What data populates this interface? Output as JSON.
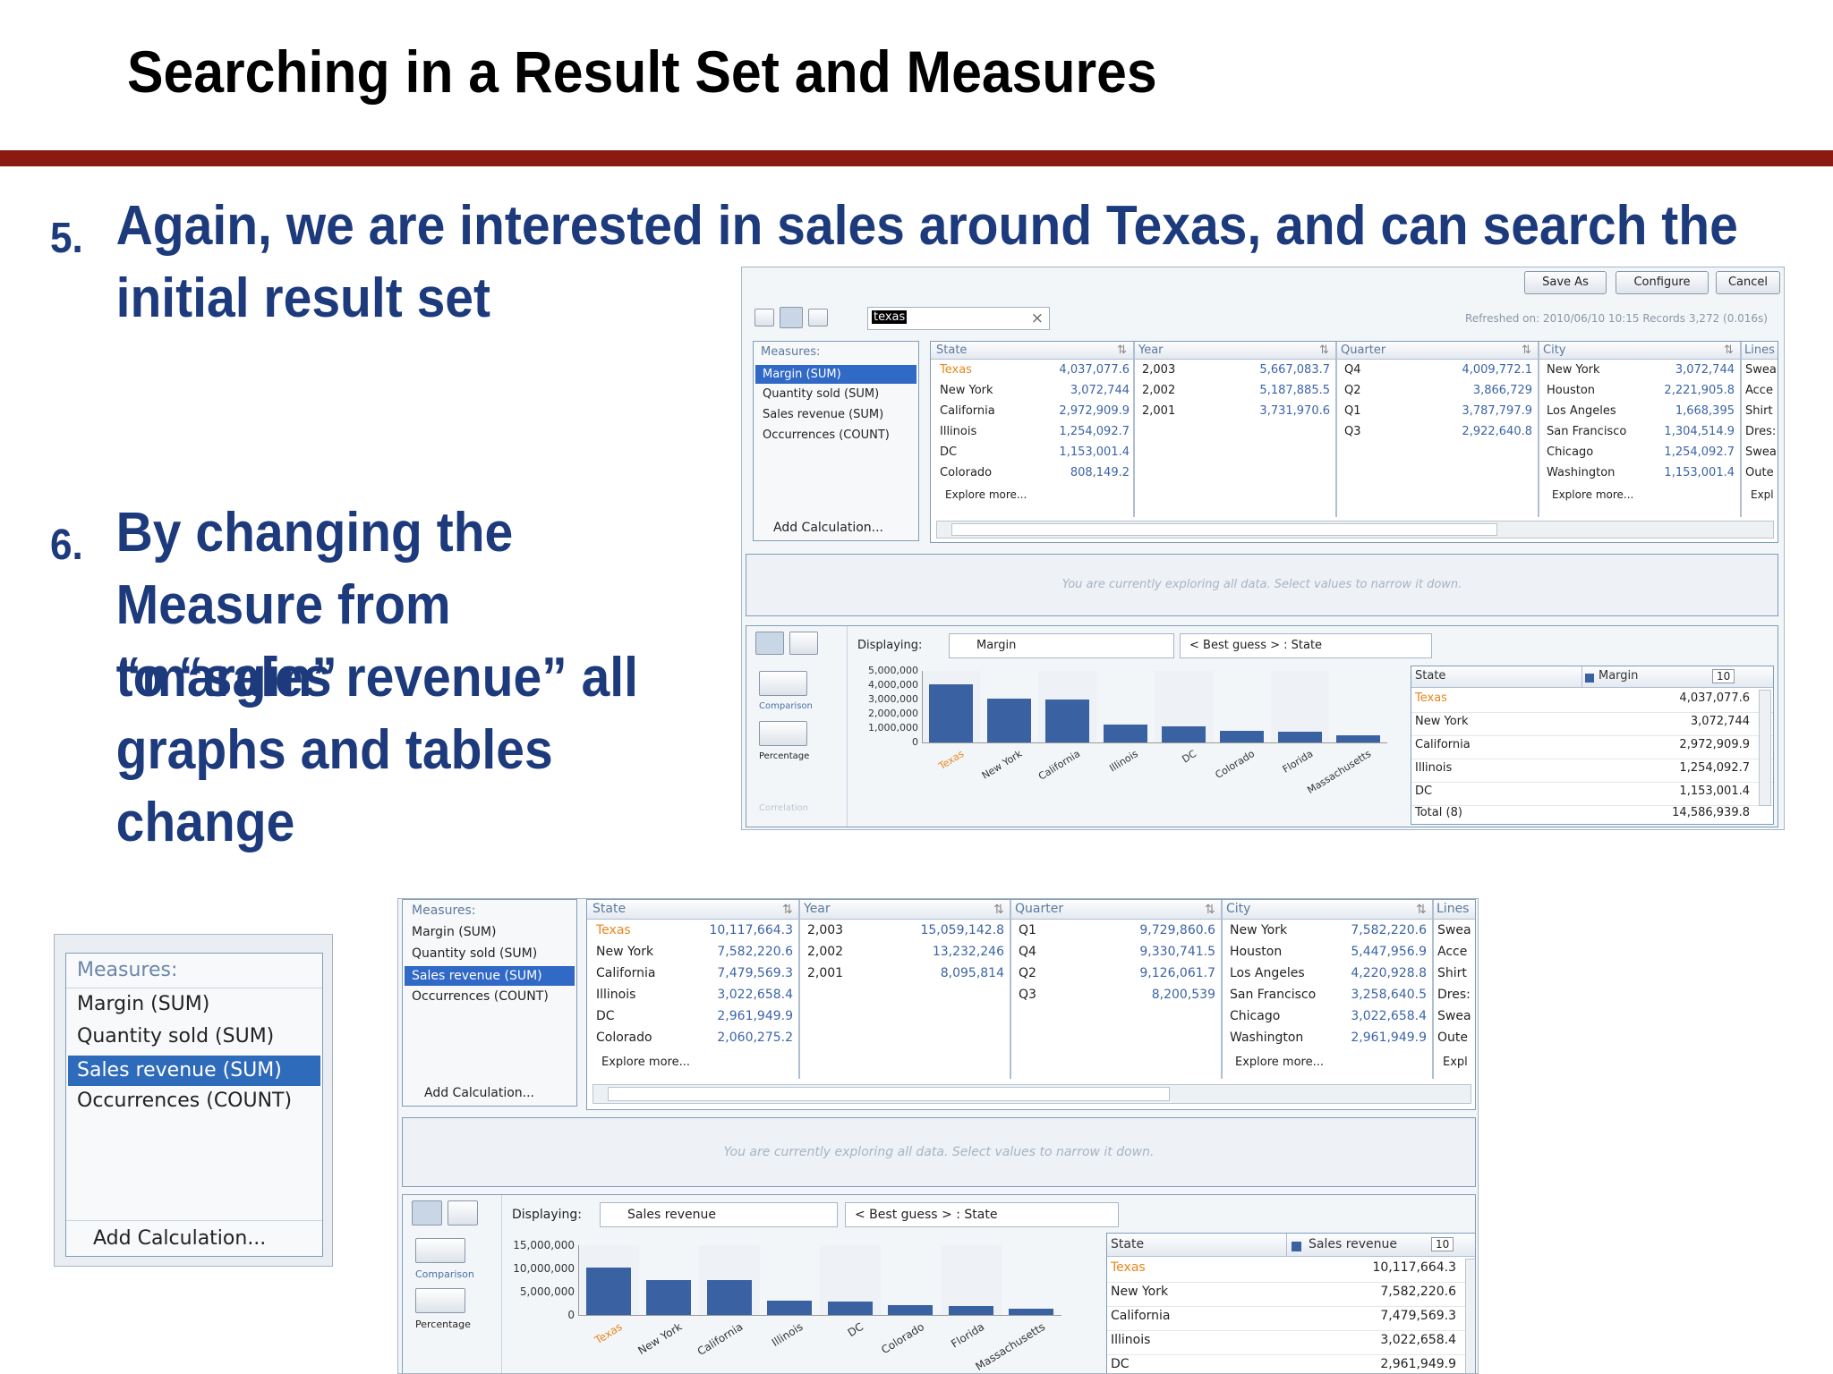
{
  "slide": {
    "title": "Searching in a Result Set and Measures",
    "b5_num": "5.",
    "b5_line1": "Again, we are interested in sales around Texas, and can search the",
    "b5_line2": "initial result set",
    "b6_num": "6.",
    "b6_lines": [
      "By changing the",
      "Measure from “margin”",
      "to “sales revenue” all",
      "graphs and tables",
      "change"
    ]
  },
  "top": {
    "buttons": {
      "save_as": "Save As",
      "configure": "Configure",
      "cancel": "Cancel"
    },
    "search_value": "texas",
    "clear_glyph": "×",
    "refreshed": "Refreshed on: 2010/06/10 10:15 Records 3,272 (0.016s)",
    "measures": {
      "header": "Measures:",
      "items": [
        "Margin (SUM)",
        "Quantity sold (SUM)",
        "Sales revenue (SUM)",
        "Occurrences (COUNT)"
      ],
      "selected": 0,
      "add": "Add Calculation..."
    },
    "facets": {
      "state": {
        "header": "State",
        "names": [
          "Texas",
          "New York",
          "California",
          "Illinois",
          "DC",
          "Colorado"
        ],
        "values": [
          "4,037,077.6",
          "3,072,744",
          "2,972,909.9",
          "1,254,092.7",
          "1,153,001.4",
          "808,149.2"
        ],
        "more": "Explore more..."
      },
      "year": {
        "header": "Year",
        "names": [
          "2,003",
          "2,002",
          "2,001"
        ],
        "values": [
          "5,667,083.7",
          "5,187,885.5",
          "3,731,970.6"
        ]
      },
      "quarter": {
        "header": "Quarter",
        "names": [
          "Q4",
          "Q2",
          "Q1",
          "Q3"
        ],
        "values": [
          "4,009,772.1",
          "3,866,729",
          "3,787,797.9",
          "2,922,640.8"
        ]
      },
      "city": {
        "header": "City",
        "names": [
          "New York",
          "Houston",
          "Los Angeles",
          "San Francisco",
          "Chicago",
          "Washington"
        ],
        "values": [
          "3,072,744",
          "2,221,905.8",
          "1,668,395",
          "1,304,514.9",
          "1,254,092.7",
          "1,153,001.4"
        ],
        "more": "Explore more..."
      },
      "lines": {
        "header": "Lines",
        "names": [
          "Swea",
          "Acce",
          "Shirt",
          "Dres:",
          "Swea",
          "Oute"
        ],
        "more": "Expl"
      }
    },
    "note": "You are currently exploring all data. Select values to narrow it down.",
    "displaying_label": "Displaying:",
    "measure_dd": "Margin",
    "dimension_dd": "< Best guess > : State",
    "side": {
      "comparison": "Comparison",
      "percentage": "Percentage",
      "correlation": "Correlation"
    },
    "table": {
      "col1": "State",
      "col2": "Margin",
      "count": "10",
      "rows": [
        [
          "Texas",
          "4,037,077.6"
        ],
        [
          "New York",
          "3,072,744"
        ],
        [
          "California",
          "2,972,909.9"
        ],
        [
          "Illinois",
          "1,254,092.7"
        ],
        [
          "DC",
          "1,153,001.4"
        ]
      ],
      "total_label": "Total (8)",
      "total_value": "14,586,939.8"
    }
  },
  "zoom": {
    "header": "Measures:",
    "items": [
      "Margin (SUM)",
      "Quantity sold (SUM)",
      "Sales revenue (SUM)",
      "Occurrences (COUNT)"
    ],
    "selected": 2,
    "add": "Add Calculation..."
  },
  "bottom": {
    "measures": {
      "header": "Measures:",
      "items": [
        "Margin (SUM)",
        "Quantity sold (SUM)",
        "Sales revenue (SUM)",
        "Occurrences (COUNT)"
      ],
      "selected": 2,
      "add": "Add Calculation..."
    },
    "facets": {
      "state": {
        "header": "State",
        "names": [
          "Texas",
          "New York",
          "California",
          "Illinois",
          "DC",
          "Colorado"
        ],
        "values": [
          "10,117,664.3",
          "7,582,220.6",
          "7,479,569.3",
          "3,022,658.4",
          "2,961,949.9",
          "2,060,275.2"
        ],
        "more": "Explore more..."
      },
      "year": {
        "header": "Year",
        "names": [
          "2,003",
          "2,002",
          "2,001"
        ],
        "values": [
          "15,059,142.8",
          "13,232,246",
          "8,095,814"
        ]
      },
      "quarter": {
        "header": "Quarter",
        "names": [
          "Q1",
          "Q4",
          "Q2",
          "Q3"
        ],
        "values": [
          "9,729,860.6",
          "9,330,741.5",
          "9,126,061.7",
          "8,200,539"
        ]
      },
      "city": {
        "header": "City",
        "names": [
          "New York",
          "Houston",
          "Los Angeles",
          "San Francisco",
          "Chicago",
          "Washington"
        ],
        "values": [
          "7,582,220.6",
          "5,447,956.9",
          "4,220,928.8",
          "3,258,640.5",
          "3,022,658.4",
          "2,961,949.9"
        ],
        "more": "Explore more..."
      },
      "lines": {
        "header": "Lines",
        "names": [
          "Swea",
          "Acce",
          "Shirt",
          "Dres:",
          "Swea",
          "Oute"
        ],
        "more": "Expl"
      }
    },
    "note": "You are currently exploring all data. Select values to narrow it down.",
    "displaying_label": "Displaying:",
    "measure_dd": "Sales revenue",
    "dimension_dd": "< Best guess > : State",
    "side": {
      "comparison": "Comparison",
      "percentage": "Percentage"
    },
    "table": {
      "col1": "State",
      "col2": "Sales revenue",
      "count": "10",
      "rows": [
        [
          "Texas",
          "10,117,664.3"
        ],
        [
          "New York",
          "7,582,220.6"
        ],
        [
          "California",
          "7,479,569.3"
        ],
        [
          "Illinois",
          "3,022,658.4"
        ],
        [
          "DC",
          "2,961,949.9"
        ]
      ]
    }
  },
  "chart_data": [
    {
      "type": "bar",
      "categories": [
        "Texas",
        "New York",
        "California",
        "Illinois",
        "DC",
        "Colorado",
        "Florida",
        "Massachusetts"
      ],
      "values": [
        4037077.6,
        3072744,
        2972909.9,
        1254092.7,
        1153001.4,
        808149.2,
        750000,
        510000
      ],
      "yticks": [
        "5,000,000",
        "4,000,000",
        "3,000,000",
        "2,000,000",
        "1,000,000",
        "0"
      ],
      "ylim": [
        0,
        5000000
      ]
    },
    {
      "type": "bar",
      "categories": [
        "Texas",
        "New York",
        "California",
        "Illinois",
        "DC",
        "Colorado",
        "Florida",
        "Massachusetts"
      ],
      "values": [
        10117664.3,
        7582220.6,
        7479569.3,
        3022658.4,
        2961949.9,
        2060275.2,
        1900000,
        1300000
      ],
      "yticks": [
        "15,000,000",
        "10,000,000",
        "5,000,000",
        "0"
      ],
      "ylim": [
        0,
        15000000
      ]
    }
  ]
}
